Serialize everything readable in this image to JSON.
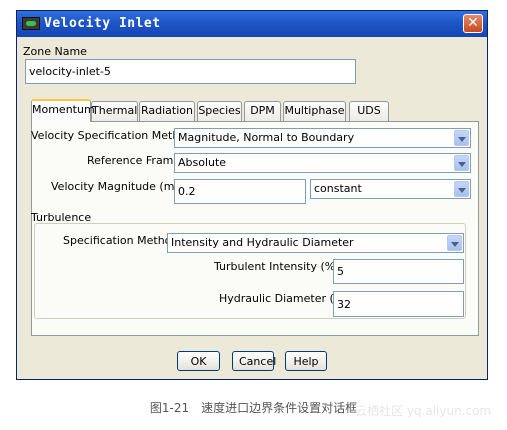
{
  "window": {
    "title": "Velocity Inlet",
    "close_label": "✕"
  },
  "zone": {
    "label": "Zone Name",
    "value": "velocity-inlet-5"
  },
  "tabs": [
    {
      "label": "Momentum",
      "active": true
    },
    {
      "label": "Thermal",
      "active": false
    },
    {
      "label": "Radiation",
      "active": false
    },
    {
      "label": "Species",
      "active": false
    },
    {
      "label": "DPM",
      "active": false
    },
    {
      "label": "Multiphase",
      "active": false
    },
    {
      "label": "UDS",
      "active": false
    }
  ],
  "momentum": {
    "velocity_spec_label": "Velocity Specification Method",
    "velocity_spec_value": "Magnitude, Normal to Boundary",
    "reference_frame_label": "Reference Frame",
    "reference_frame_value": "Absolute",
    "velocity_magnitude_label": "Velocity Magnitude (m/s)",
    "velocity_magnitude_value": "0.2",
    "velocity_magnitude_mode": "constant"
  },
  "turbulence": {
    "section_label": "Turbulence",
    "spec_method_label": "Specification Method",
    "spec_method_value": "Intensity and Hydraulic Diameter",
    "intensity_label": "Turbulent Intensity (%)",
    "intensity_value": "5",
    "diameter_label": "Hydraulic Diameter (in)",
    "diameter_value": "32"
  },
  "buttons": {
    "ok": "OK",
    "cancel": "Cancel",
    "help": "Help"
  },
  "caption": "图1-21　速度进口边界条件设置对话框",
  "watermark": "云栖社区 yq.aliyun.com"
}
